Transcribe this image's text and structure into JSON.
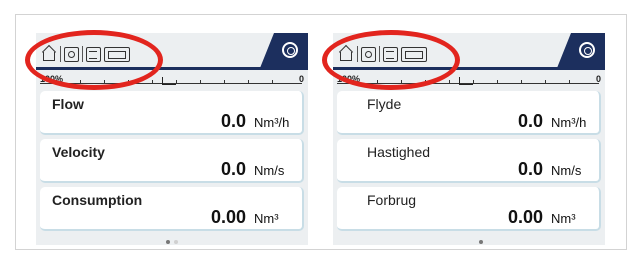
{
  "screens": [
    {
      "id": "english",
      "scale": {
        "left_label": "100%",
        "right_label": "0"
      },
      "rows": [
        {
          "label": "Flow",
          "value": "0.0",
          "unit": "Nm³/h"
        },
        {
          "label": "Velocity",
          "value": "0.0",
          "unit": "Nm/s"
        },
        {
          "label": "Consumption",
          "value": "0.00",
          "unit": "Nm³"
        }
      ],
      "pager": {
        "active_index": 0,
        "count": 2
      }
    },
    {
      "id": "danish",
      "scale": {
        "left_label": "100%",
        "right_label": "0"
      },
      "rows": [
        {
          "label": "Flyde",
          "value": "0.0",
          "unit": "Nm³/h"
        },
        {
          "label": "Hastighed",
          "value": "0.0",
          "unit": "Nm/s"
        },
        {
          "label": "Forbrug",
          "value": "0.00",
          "unit": "Nm³"
        }
      ],
      "pager": {
        "active_index": 0,
        "count": 1
      }
    }
  ],
  "icons": [
    "home-icon",
    "camera-icon",
    "document-icon",
    "battery-icon",
    "gear-icon"
  ],
  "colors": {
    "highlight": "#e2251e",
    "navy": "#1c2f5e",
    "panel": "#eceff1"
  }
}
